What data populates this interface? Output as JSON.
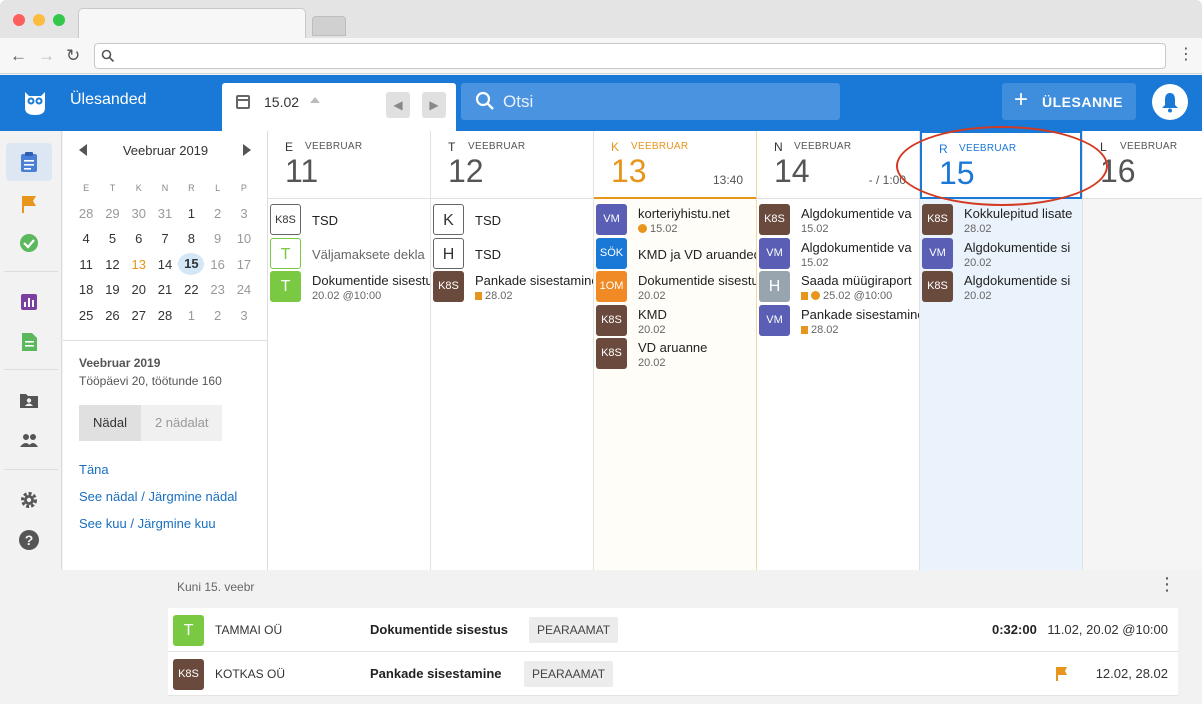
{
  "app": {
    "title": "Ülesanded",
    "current_date": "15.02",
    "search_placeholder": "Otsi",
    "add_button": "ÜLESANNE"
  },
  "mini_calendar": {
    "month": "Veebruar 2019",
    "weekdays": [
      "E",
      "T",
      "K",
      "N",
      "R",
      "L",
      "P"
    ],
    "weeks": [
      [
        "28",
        "29",
        "30",
        "31",
        "1",
        "2",
        "3"
      ],
      [
        "4",
        "5",
        "6",
        "7",
        "8",
        "9",
        "10"
      ],
      [
        "11",
        "12",
        "13",
        "14",
        "15",
        "16",
        "17"
      ],
      [
        "18",
        "19",
        "20",
        "21",
        "22",
        "23",
        "24"
      ],
      [
        "25",
        "26",
        "27",
        "28",
        "1",
        "2",
        "3"
      ]
    ],
    "today": "13",
    "selected": "15"
  },
  "sidebar": {
    "month_title": "Veebruar 2019",
    "month_info": "Tööpäevi 20, töötunde 160",
    "view_week": "Nädal",
    "view_two_weeks": "2 nädalat",
    "link_today": "Täna",
    "link_this_week": "See nädal",
    "link_next_week": "Järgmine nädal",
    "link_this_month": "See kuu",
    "link_next_month": "Järgmine kuu",
    "separator": "/"
  },
  "days": [
    {
      "letter": "E",
      "month": "VEEBRUAR",
      "num": "11",
      "extra": "",
      "tasks": [
        {
          "badge": "K8S",
          "style": "outline",
          "name": "TSD",
          "sub": ""
        },
        {
          "badge": "T",
          "style": "outline-g",
          "name": "Väljamaksete dekla",
          "sub": ""
        },
        {
          "badge": "T",
          "style": "green",
          "name": "Dokumentide sisestus",
          "sub": "20.02 @10:00"
        }
      ]
    },
    {
      "letter": "T",
      "month": "VEEBRUAR",
      "num": "12",
      "extra": "",
      "tasks": [
        {
          "badge": "K",
          "style": "outline",
          "name": "TSD",
          "sub": ""
        },
        {
          "badge": "H",
          "style": "outline",
          "name": "TSD",
          "sub": ""
        },
        {
          "badge": "K8S",
          "style": "brown",
          "name": "Pankade sisestamine",
          "sub": "28.02",
          "flag": true
        }
      ]
    },
    {
      "letter": "K",
      "month": "VEEBRUAR",
      "num": "13",
      "extra": "13:40",
      "tasks": [
        {
          "badge": "VM",
          "style": "purple",
          "name": "korteriyhistu.net",
          "sub": "15.02",
          "coin": true
        },
        {
          "badge": "SÖK",
          "style": "blue",
          "name": "KMD ja VD aruanded",
          "sub": ""
        },
        {
          "badge": "1OM",
          "style": "orange",
          "name": "Dokumentide sisestus",
          "sub": "20.02"
        },
        {
          "badge": "K8S",
          "style": "brown",
          "name": "KMD",
          "sub": "20.02"
        },
        {
          "badge": "K8S",
          "style": "brown",
          "name": "VD aruanne",
          "sub": "20.02"
        }
      ]
    },
    {
      "letter": "N",
      "month": "VEEBRUAR",
      "num": "14",
      "extra": "- / 1:00",
      "tasks": [
        {
          "badge": "K8S",
          "style": "brown",
          "name": "Algdokumentide va",
          "sub": "15.02"
        },
        {
          "badge": "VM",
          "style": "purple",
          "name": "Algdokumentide va",
          "sub": "15.02"
        },
        {
          "badge": "H",
          "style": "grey",
          "name": "Saada müügiraport",
          "sub": "25.02 @10:00",
          "flag": true,
          "coin": true
        },
        {
          "badge": "VM",
          "style": "purple",
          "name": "Pankade sisestamine",
          "sub": "28.02",
          "flag": true
        }
      ]
    },
    {
      "letter": "R",
      "month": "VEEBRUAR",
      "num": "15",
      "extra": "",
      "tasks": [
        {
          "badge": "K8S",
          "style": "brown",
          "name": "Kokkulepitud lisate",
          "sub": "28.02"
        },
        {
          "badge": "VM",
          "style": "purple",
          "name": "Algdokumentide si",
          "sub": "20.02"
        },
        {
          "badge": "K8S",
          "style": "brown",
          "name": "Algdokumentide si",
          "sub": "20.02"
        }
      ]
    },
    {
      "letter": "L",
      "month": "VEEBRUAR",
      "num": "16",
      "extra": "",
      "tasks": []
    }
  ],
  "lower": {
    "heading": "Kuni 15. veebr",
    "rows": [
      {
        "badge": "T",
        "badge_color": "#7ac943",
        "company": "TAMMAI OÜ",
        "task": "Dokumentide sisestus",
        "tag": "PEARAAMAT",
        "time": "0:32:00",
        "dates": "11.02, 20.02 @10:00",
        "flag": false
      },
      {
        "badge": "K8S",
        "badge_color": "#6b4a3e",
        "company": "KOTKAS OÜ",
        "task": "Pankade sisestamine",
        "tag": "PEARAAMAT",
        "time": "",
        "dates": "12.02, 28.02",
        "flag": true
      }
    ]
  },
  "colors": {
    "brand": "#1a78d6",
    "today": "#e8951b",
    "selected_bg": "#eaf3fb",
    "highlight_ring": "#d33a22"
  }
}
